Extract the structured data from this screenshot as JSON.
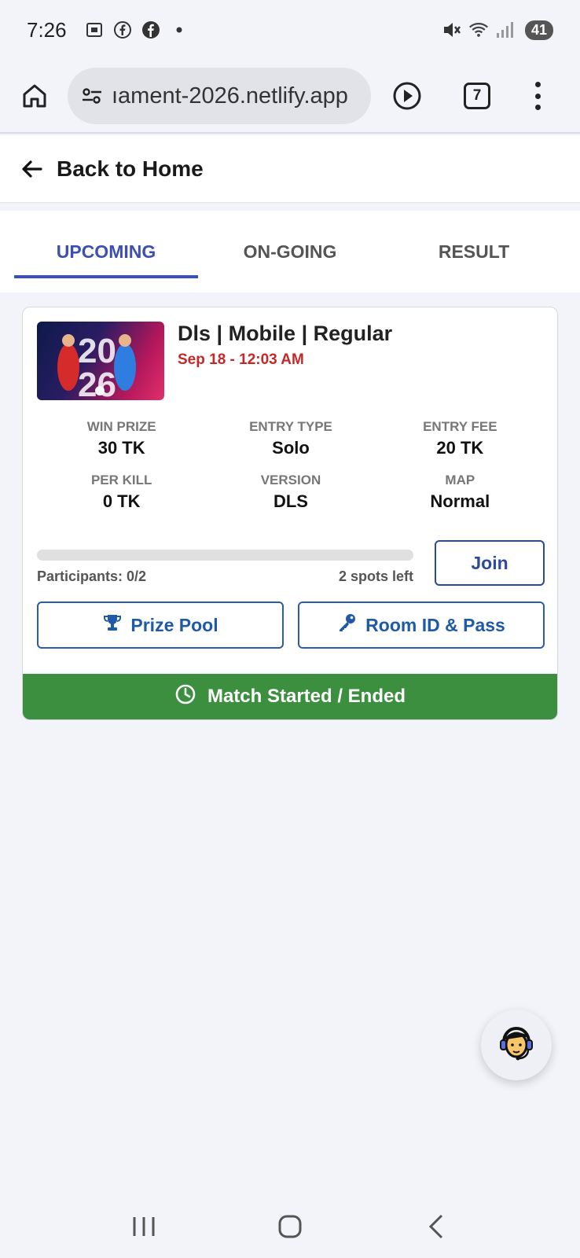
{
  "status_bar": {
    "time": "7:26",
    "battery": "41",
    "icons_left": [
      "screenshot-icon",
      "facebook-icon",
      "facebook-icon",
      "dot-icon"
    ],
    "icons_right": [
      "mute-icon",
      "wifi-icon",
      "signal-icon",
      "battery-icon"
    ]
  },
  "browser": {
    "url": "ıament-2026.netlify.app",
    "tab_count": "7"
  },
  "header": {
    "back_label": "Back to Home"
  },
  "tabs": [
    {
      "label": "UPCOMING",
      "active": true
    },
    {
      "label": "ON-GOING",
      "active": false
    },
    {
      "label": "RESULT",
      "active": false
    }
  ],
  "match": {
    "title": "Dls | Mobile | Regular",
    "datetime": "Sep 18 - 12:03 AM",
    "stats": [
      {
        "label": "WIN PRIZE",
        "value": "30 TK"
      },
      {
        "label": "ENTRY TYPE",
        "value": "Solo"
      },
      {
        "label": "ENTRY FEE",
        "value": "20 TK"
      },
      {
        "label": "PER KILL",
        "value": "0 TK"
      },
      {
        "label": "VERSION",
        "value": "DLS"
      },
      {
        "label": "MAP",
        "value": "Normal"
      }
    ],
    "participants": "Participants: 0/2",
    "spots_left": "2 spots left",
    "progress_fraction": 0,
    "join_label": "Join",
    "prize_pool_label": "Prize Pool",
    "room_label": "Room ID & Pass",
    "status_label": "Match Started / Ended",
    "colors": {
      "accent": "#3c4fb2",
      "date_red": "#c62828",
      "status_green": "#3b8f3e",
      "button_blue": "#1e5aa8"
    }
  }
}
